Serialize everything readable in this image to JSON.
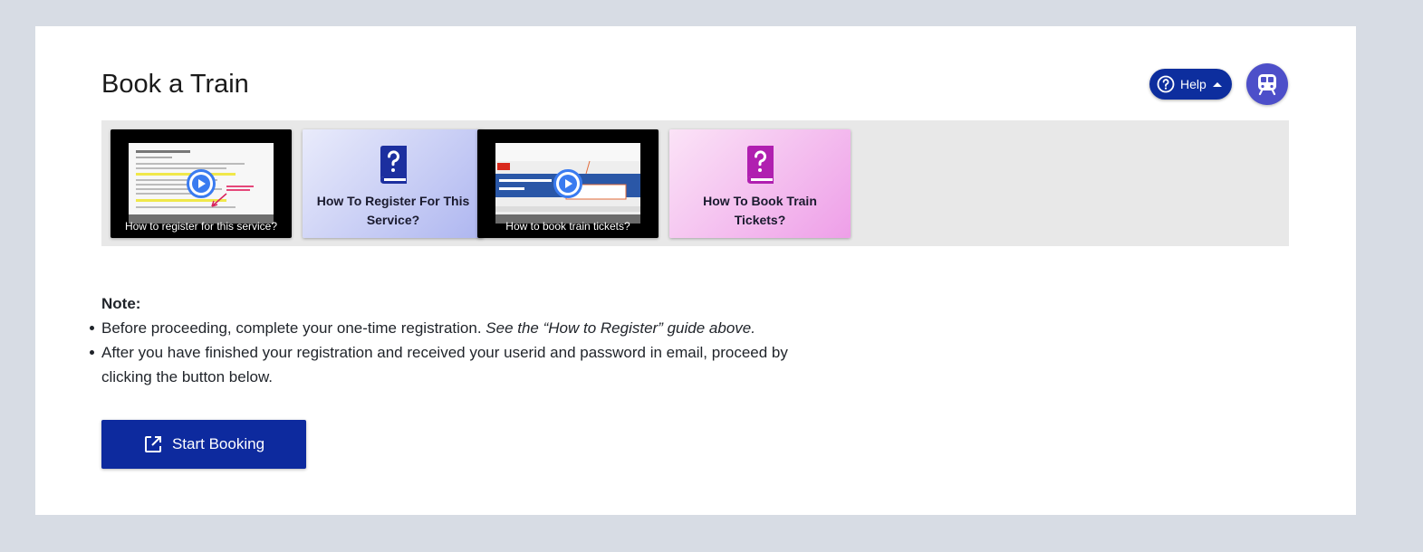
{
  "page": {
    "title": "Book a Train"
  },
  "header": {
    "help_label": "Help",
    "help_icon": "question-circle-icon",
    "caret_icon": "caret-up-icon",
    "avatar_icon": "train-icon",
    "avatar_color": "#4d4fc9",
    "help_color": "#0d2e9e"
  },
  "tiles": [
    {
      "kind": "video",
      "caption": "How to register for this service?"
    },
    {
      "kind": "guide",
      "title": "How To Register For This Service?",
      "icon": "help-book-icon",
      "icon_color": "#1c2f9f"
    },
    {
      "kind": "video",
      "caption": "How to book train tickets?"
    },
    {
      "kind": "guide",
      "title": "How To Book Train Tickets?",
      "icon": "help-book-icon",
      "icon_color": "#b01fb0"
    }
  ],
  "note": {
    "heading": "Note:",
    "item1_text": "Before proceeding, complete your one-time registration. ",
    "item1_emphasis": "See the “How to Register” guide above.",
    "item2_text": "After you have finished your registration and received your userid and password in email, proceed by clicking the button below."
  },
  "action": {
    "start_label": "Start Booking",
    "start_icon": "open-in-new-icon",
    "button_color": "#0d2a9e"
  }
}
